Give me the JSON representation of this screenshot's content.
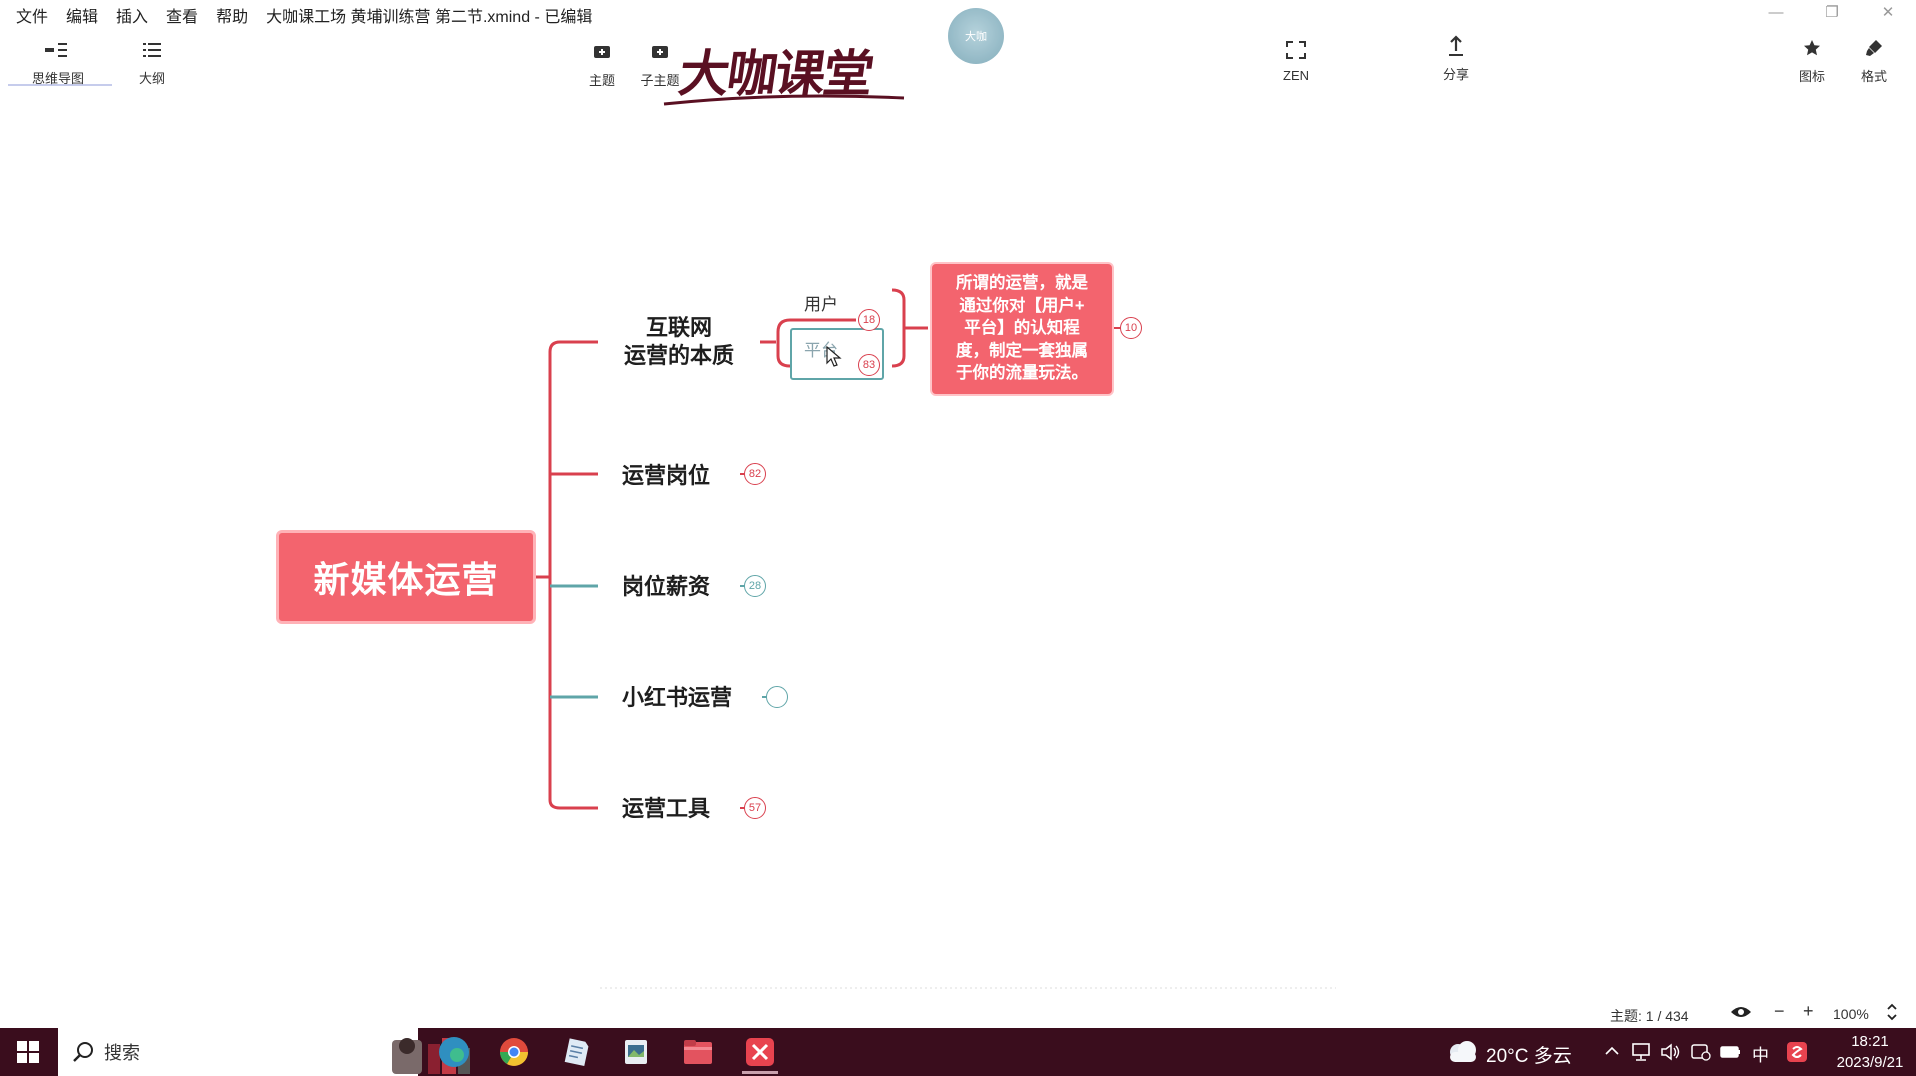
{
  "menu": {
    "items": [
      "文件",
      "编辑",
      "插入",
      "查看",
      "帮助"
    ],
    "document_title": "大咖课工场 黄埔训练营 第二节.xmind - 已编辑"
  },
  "toolbar": {
    "mindmap_label": "思维导图",
    "outline_label": "大纲",
    "topic_label": "主题",
    "subtopic_label": "子主题",
    "zen_label": "ZEN",
    "share_label": "分享",
    "icon_label": "图标",
    "format_label": "格式"
  },
  "watermark": {
    "logo_text": "大咖课堂",
    "avatar_text": "大咖"
  },
  "mindmap": {
    "central": "新媒体运营",
    "topics": [
      {
        "label": "互联网运营的本质",
        "lines": [
          "互联网",
          "运营的本质"
        ],
        "color": "#d9404e"
      },
      {
        "label": "运营岗位",
        "badge": "82",
        "color": "#d9404e"
      },
      {
        "label": "岗位薪资",
        "badge": "28",
        "color": "#5fa5a8"
      },
      {
        "label": "小红书运营",
        "badge": "",
        "color": "#5fa5a8"
      },
      {
        "label": "运营工具",
        "badge": "57",
        "color": "#d9404e"
      }
    ],
    "subtopics": [
      {
        "label": "用户",
        "badge": "18"
      },
      {
        "label": "平台",
        "badge": "83"
      }
    ],
    "callout": {
      "text": "所谓的运营，就是通过你对【用户+平台】的认知程度，制定一套独属于你的流量玩法。",
      "lines": [
        "所谓的运营，就是",
        "通过你对【用户+",
        "平台】的认知程",
        "度，制定一套独属",
        "于你的流量玩法。"
      ],
      "badge": "10"
    }
  },
  "status": {
    "topics_text": "主题: 1 / 434",
    "zoom": "100%",
    "zoom_out": "−",
    "zoom_in": "+"
  },
  "taskbar": {
    "search_placeholder": "搜索",
    "weather": "20°C 多云",
    "ime": "中",
    "time": "18:21",
    "date": "2023/9/21"
  },
  "colors": {
    "accent_red": "#f3646e",
    "branch_red": "#d9404e",
    "branch_teal": "#5fa5a8",
    "taskbar": "#3a0d1d"
  }
}
